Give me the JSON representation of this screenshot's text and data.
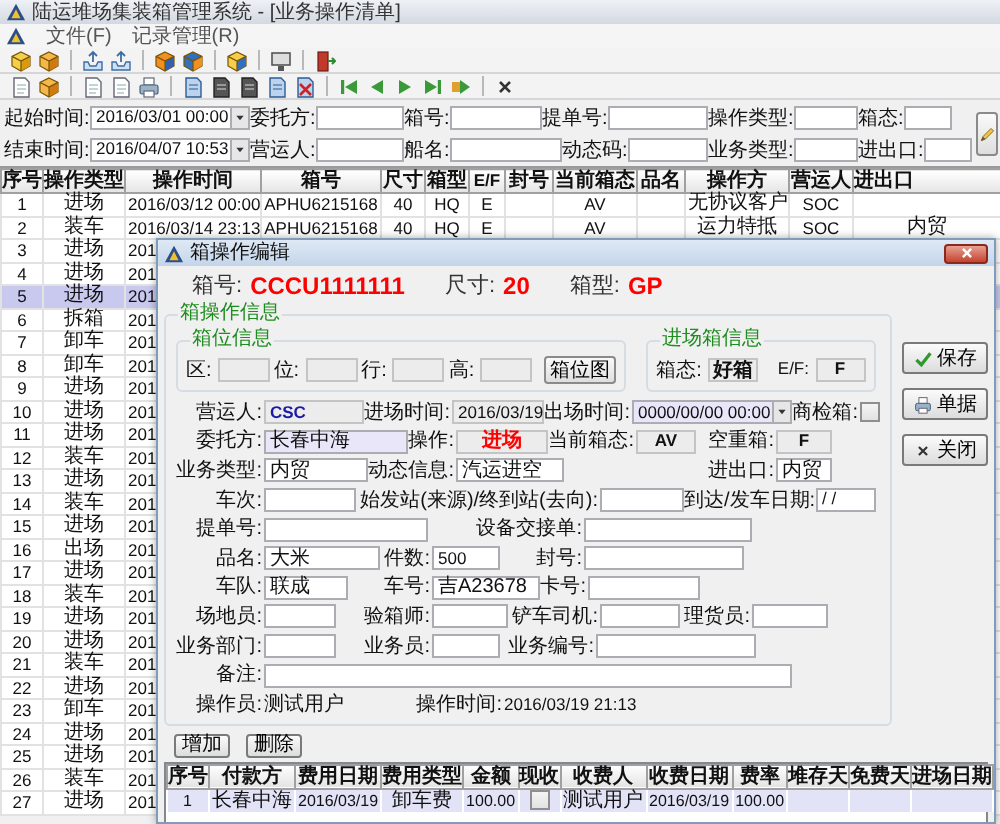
{
  "window": {
    "title": "陆运堆场集装箱管理系统 - [业务操作清单]"
  },
  "menu": [
    {
      "label": "文件(F)"
    },
    {
      "label": "记录管理(R)"
    }
  ],
  "filters": [
    [
      {
        "label": "起始时间:",
        "value": "2016/03/01 00:00",
        "kind": "combo"
      },
      {
        "label": "委托方:",
        "kind": "input"
      },
      {
        "label": "箱号:",
        "kind": "input"
      },
      {
        "label": "提单号:",
        "kind": "input"
      },
      {
        "label": "操作类型:",
        "kind": "input"
      },
      {
        "label": "箱态:",
        "kind": "input"
      }
    ],
    [
      {
        "label": "结束时间:",
        "value": "2016/04/07 10:53",
        "kind": "combo"
      },
      {
        "label": "营运人:",
        "kind": "input"
      },
      {
        "label": "船名:",
        "kind": "input"
      },
      {
        "label": "动态码:",
        "kind": "input"
      },
      {
        "label": "业务类型:",
        "kind": "input"
      },
      {
        "label": "进出口:",
        "kind": "input"
      }
    ]
  ],
  "table": {
    "columns": [
      "序号",
      "操作类型",
      "操作时间",
      "箱号",
      "尺寸",
      "箱型",
      "E/F",
      "封号",
      "当前箱态",
      "品名",
      "操作方",
      "营运人",
      "进出口"
    ],
    "rows": [
      {
        "cells": [
          "1",
          "进场",
          "2016/03/12 00:00",
          "APHU6215168",
          "40",
          "HQ",
          "E",
          null,
          "AV",
          null,
          "无协议客户",
          "SOC",
          null
        ],
        "selected": false
      },
      {
        "cells": [
          "2",
          "装车",
          "2016/03/14 23:13",
          "APHU6215168",
          "40",
          "HQ",
          "E",
          null,
          "AV",
          null,
          "运力特抵",
          "SOC",
          "内贸"
        ],
        "selected": false
      },
      {
        "cells": [
          "3",
          "进场",
          "201"
        ],
        "selected": false
      },
      {
        "cells": [
          "4",
          "进场",
          "201"
        ],
        "selected": false
      },
      {
        "cells": [
          "5",
          "进场",
          "201"
        ],
        "selected": true
      },
      {
        "cells": [
          "6",
          "拆箱",
          "201"
        ],
        "selected": false
      },
      {
        "cells": [
          "7",
          "卸车",
          "201"
        ],
        "selected": false
      },
      {
        "cells": [
          "8",
          "卸车",
          "201"
        ],
        "selected": false
      },
      {
        "cells": [
          "9",
          "进场",
          "201"
        ],
        "selected": false
      },
      {
        "cells": [
          "10",
          "进场",
          "201"
        ],
        "selected": false
      },
      {
        "cells": [
          "11",
          "进场",
          "201"
        ],
        "selected": false
      },
      {
        "cells": [
          "12",
          "装车",
          "201"
        ],
        "selected": false
      },
      {
        "cells": [
          "13",
          "进场",
          "201"
        ],
        "selected": false
      },
      {
        "cells": [
          "14",
          "装车",
          "201"
        ],
        "selected": false
      },
      {
        "cells": [
          "15",
          "进场",
          "201"
        ],
        "selected": false
      },
      {
        "cells": [
          "16",
          "出场",
          "201"
        ],
        "selected": false
      },
      {
        "cells": [
          "17",
          "进场",
          "201"
        ],
        "selected": false
      },
      {
        "cells": [
          "18",
          "装车",
          "201"
        ],
        "selected": false
      },
      {
        "cells": [
          "19",
          "进场",
          "201"
        ],
        "selected": false
      },
      {
        "cells": [
          "20",
          "进场",
          "201"
        ],
        "selected": false
      },
      {
        "cells": [
          "21",
          "装车",
          "201"
        ],
        "selected": false
      },
      {
        "cells": [
          "22",
          "进场",
          "201"
        ],
        "selected": false
      },
      {
        "cells": [
          "23",
          "卸车",
          "201"
        ],
        "selected": false
      },
      {
        "cells": [
          "24",
          "进场",
          "201"
        ],
        "selected": false
      },
      {
        "cells": [
          "25",
          "进场",
          "201"
        ],
        "selected": false
      },
      {
        "cells": [
          "26",
          "装车",
          "201"
        ],
        "selected": false
      },
      {
        "cells": [
          "27",
          "进场",
          "201"
        ],
        "selected": false
      }
    ]
  },
  "dialog": {
    "title": "箱操作编辑",
    "header": [
      {
        "label": "箱号:",
        "value": "CCCU1111111"
      },
      {
        "label": "尺寸:",
        "value": "20"
      },
      {
        "label": "箱型:",
        "value": "GP"
      }
    ],
    "group_title": "箱操作信息",
    "slot_group": {
      "title": "箱位信息",
      "fields": [
        {
          "label": "区:"
        },
        {
          "label": "位:"
        },
        {
          "label": "行:"
        },
        {
          "label": "高:"
        }
      ],
      "button": "箱位图"
    },
    "entry_group": {
      "title": "进场箱信息",
      "fields": [
        {
          "label": "箱态:",
          "value": "好箱"
        },
        {
          "label": "E/F:",
          "value": "F"
        }
      ]
    },
    "rows": [
      [
        {
          "label": "营运人:",
          "value": "CSC",
          "kind": "readonly",
          "color": "#1a1aa6"
        },
        {
          "label": "进场时间:",
          "value": "2016/03/19",
          "kind": "readonly"
        },
        {
          "label": "出场时间:",
          "value": "0000/00/00 00:00",
          "kind": "combo"
        },
        {
          "label": "商检箱:",
          "kind": "checkbox",
          "checked": false
        }
      ],
      [
        {
          "label": "委托方:",
          "value": "长春中海",
          "kind": "highlight"
        },
        {
          "label": "操作:",
          "value": "进场",
          "kind": "readonly",
          "color": "#ff0000"
        },
        {
          "label": "当前箱态:",
          "value": "AV",
          "kind": "readonly"
        },
        {
          "label": "空重箱:",
          "value": "F",
          "kind": "readonly"
        }
      ],
      [
        {
          "label": "业务类型:",
          "value": "内贸",
          "kind": "input"
        },
        {
          "label": "动态信息:",
          "value": "汽运进空",
          "kind": "input"
        },
        {
          "label": "进出口:",
          "value": "内贸",
          "kind": "input"
        }
      ],
      [
        {
          "label": "车次:",
          "kind": "input"
        },
        {
          "label": "始发站(来源)/终到站(去向):",
          "kind": "input"
        },
        {
          "label": "到达/发车日期:",
          "value": "/ /",
          "kind": "input"
        }
      ],
      [
        {
          "label": "提单号:",
          "kind": "input"
        },
        {
          "label": "设备交接单:",
          "kind": "input"
        }
      ],
      [
        {
          "label": "品名:",
          "value": "大米",
          "kind": "input"
        },
        {
          "label": "件数:",
          "value": "500",
          "kind": "input"
        },
        {
          "label": "封号:",
          "kind": "input"
        }
      ],
      [
        {
          "label": "车队:",
          "value": "联成",
          "kind": "input"
        },
        {
          "label": "车号:",
          "value": "吉A23678",
          "kind": "input"
        },
        {
          "label": "卡号:",
          "kind": "input"
        }
      ],
      [
        {
          "label": "场地员:",
          "kind": "input"
        },
        {
          "label": "验箱师:",
          "kind": "input"
        },
        {
          "label": "铲车司机:",
          "kind": "input"
        },
        {
          "label": "理货员:",
          "kind": "input"
        }
      ],
      [
        {
          "label": "业务部门:",
          "kind": "input"
        },
        {
          "label": "业务员:",
          "kind": "input"
        },
        {
          "label": "业务编号:",
          "kind": "input"
        }
      ],
      [
        {
          "label": "备注:",
          "kind": "input"
        }
      ],
      [
        {
          "label": "操作员:",
          "value": "测试用户",
          "kind": "plain"
        },
        {
          "label": "操作时间:",
          "value": "2016/03/19 21:13",
          "kind": "plain"
        }
      ]
    ],
    "side_buttons": [
      {
        "label": "保存",
        "kind": "save"
      },
      {
        "label": "单据",
        "kind": "print"
      },
      {
        "label": "关闭",
        "kind": "close"
      }
    ],
    "buttons": [
      "增加",
      "删除"
    ],
    "fees": {
      "columns": [
        {
          "label": "序号",
          "kind": "text"
        },
        {
          "label": "付款方",
          "kind": "text"
        },
        {
          "label": "费用日期",
          "kind": "text"
        },
        {
          "label": "费用类型",
          "kind": "text"
        },
        {
          "label": "金额",
          "kind": "number"
        },
        {
          "label": "现收",
          "kind": "check"
        },
        {
          "label": "收费人",
          "kind": "text"
        },
        {
          "label": "收费日期",
          "kind": "text"
        },
        {
          "label": "费率",
          "kind": "number"
        },
        {
          "label": "堆存天",
          "kind": "text"
        },
        {
          "label": "免费天",
          "kind": "text"
        },
        {
          "label": "进场日期",
          "kind": "text"
        }
      ],
      "rows": [
        {
          "cells": [
            "1",
            "长春中海",
            "2016/03/19",
            "卸车费",
            "100.00",
            false,
            "测试用户",
            "2016/03/19",
            "100.00",
            null,
            null,
            null
          ],
          "selected": true
        }
      ]
    }
  }
}
